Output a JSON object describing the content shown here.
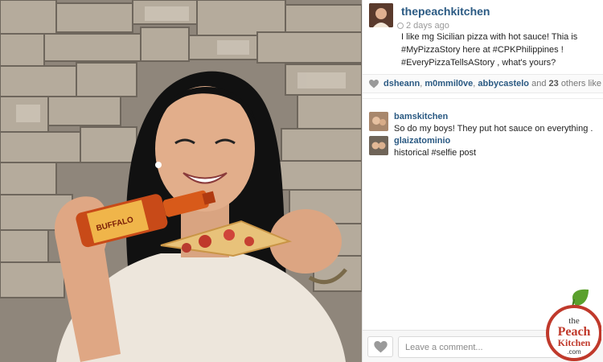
{
  "post": {
    "username": "thepeachkitchen",
    "timestamp": "2 days ago",
    "caption_lines": [
      "I like mg Sicilian pizza with hot sauce! Thia is",
      "#MyPizzaStory here at #CPKPhilippines !",
      "#EveryPizzaTellsAStory , what's yours?"
    ]
  },
  "likes": {
    "users": [
      "dsheann",
      "m0mmil0ve",
      "abbycastelo"
    ],
    "and_word": "and",
    "others_count": "23",
    "suffix": "others like this."
  },
  "comments": [
    {
      "username": "bamskitchen",
      "text": "So do my boys! They put hot sauce on everything ."
    },
    {
      "username": "glaizatominio",
      "text": "historical #selfie post"
    }
  ],
  "comment_box": {
    "placeholder": "Leave a comment..."
  },
  "photo": {
    "bottle_label": "BUFFALO"
  },
  "watermark": {
    "line1": "the",
    "line2": "Peach",
    "line3": "Kitchen",
    "line4": ".com"
  },
  "icons": {
    "like": "heart-icon",
    "likes_bar": "heart-small-icon",
    "time": "clock-icon",
    "watermark_leaf": "leaf-icon"
  },
  "colors": {
    "link": "#2b5a83",
    "text": "#222222",
    "muted": "#999999",
    "logo_red": "#c0392b",
    "logo_green": "#5aa02c"
  }
}
